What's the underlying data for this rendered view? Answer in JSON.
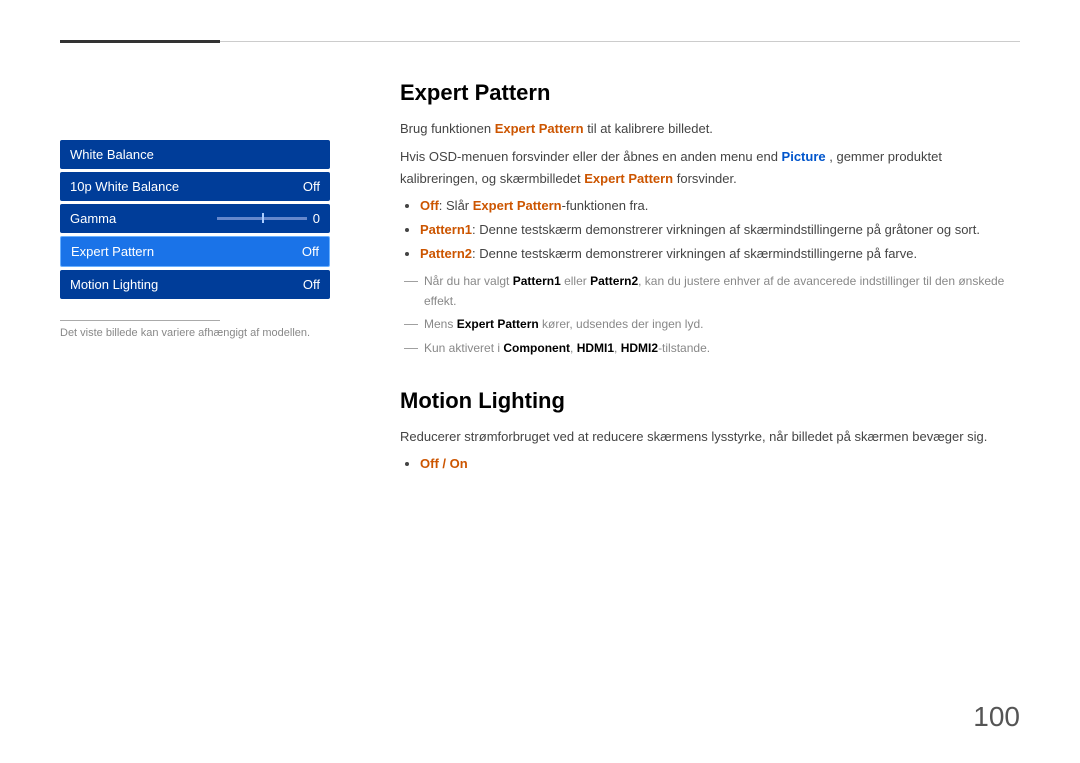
{
  "page": {
    "number": "100"
  },
  "top_lines": {
    "aria": "decorative header lines"
  },
  "sidebar": {
    "items": [
      {
        "id": "white-balance",
        "label": "White Balance",
        "value": "",
        "type": "header"
      },
      {
        "id": "ten-p-white-balance",
        "label": "10p White Balance",
        "value": "Off",
        "type": "item"
      },
      {
        "id": "gamma",
        "label": "Gamma",
        "value": "0",
        "type": "slider"
      },
      {
        "id": "expert-pattern",
        "label": "Expert Pattern",
        "value": "Off",
        "type": "item"
      },
      {
        "id": "motion-lighting",
        "label": "Motion Lighting",
        "value": "Off",
        "type": "item"
      }
    ],
    "footnote": "Det viste billede kan variere afhængigt af modellen."
  },
  "sections": [
    {
      "id": "expert-pattern",
      "title": "Expert Pattern",
      "intro1_plain": "Brug funktionen ",
      "intro1_highlight": "Expert Pattern",
      "intro1_suffix": " til at kalibrere billedet.",
      "intro2_plain": "Hvis OSD-menuen forsvinder eller der åbnes en anden menu end ",
      "intro2_highlight_blue": "Picture",
      "intro2_middle": ", gemmer produktet kalibreringen, og skærmbilledet ",
      "intro2_highlight_orange": "Expert Pattern",
      "intro2_suffix": " forsvinder.",
      "bullets": [
        {
          "label": "Off",
          "label_style": "orange",
          "text": ": Slår ",
          "bold": "Expert Pattern",
          "bold_style": "orange",
          "suffix": "-funktionen fra."
        },
        {
          "label": "Pattern1",
          "label_style": "orange",
          "text": ": Denne testskærm demonstrerer virkningen af skærmindstillingerne på gråtoner og sort."
        },
        {
          "label": "Pattern2",
          "label_style": "orange",
          "text": ": Denne testskærm demonstrerer virkningen af skærmindstillingerne på farve."
        }
      ],
      "dash_notes": [
        {
          "text_plain": "Når du har valgt ",
          "bold1": "Pattern1",
          "middle": " eller ",
          "bold2": "Pattern2",
          "suffix": ", kan du justere enhver af de avancerede indstillinger til den ønskede effekt."
        },
        {
          "text_plain": "Mens ",
          "bold": "Expert Pattern",
          "suffix": " kører, udsendes der ingen lyd."
        },
        {
          "text_plain": "Kun aktiveret i ",
          "bold1": "Component",
          "sep1": ", ",
          "bold2": "HDMI1",
          "sep2": ", ",
          "bold3": "HDMI2",
          "suffix": "-tilstande."
        }
      ]
    },
    {
      "id": "motion-lighting",
      "title": "Motion Lighting",
      "description": "Reducerer strømforbruget ved at reducere skærmens lysstyrke, når billedet på skærmen bevæger sig.",
      "bullets": [
        {
          "label": "Off / On",
          "label_style": "orange"
        }
      ]
    }
  ]
}
